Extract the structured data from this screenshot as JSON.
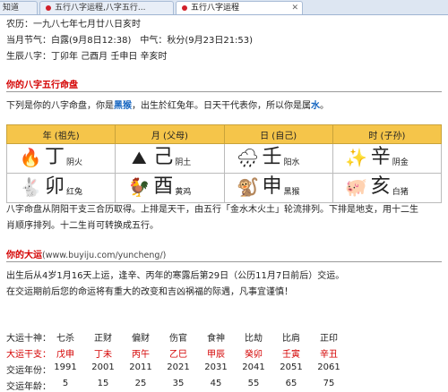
{
  "tabs": [
    {
      "label": "知道"
    },
    {
      "label": "五行八字运程,八字五行..."
    },
    {
      "label": "五行八字运程"
    }
  ],
  "header": {
    "lunar_line": "农历：一九八七年七月廿八日亥时",
    "solar_term": "当月节气：白露(9月8日12:38)　中气：秋分(9月23日21:53)",
    "birth_pillars": "生辰八字：丁卯年 己酉月 壬申日 辛亥时"
  },
  "bazi": {
    "title": "你的八字五行命盘",
    "intro_prefix": "下列是你的八字命盘，你是",
    "intro_mid1": "，出生於红兔年。日天干代表你，所以你是属",
    "intro_end": "。",
    "highlight1": "黑猴",
    "highlight2": "水",
    "headers": [
      "年 (祖先)",
      "月 (父母)",
      "日 (自己)",
      "时 (子孙)"
    ],
    "stems": [
      {
        "char": "丁",
        "desc": "阴火",
        "icon": "fire-icon",
        "glyph": "🔥"
      },
      {
        "char": "己",
        "desc": "阴土",
        "icon": "earth-icon",
        "glyph": "⛰"
      },
      {
        "char": "壬",
        "desc": "阳水",
        "icon": "rain-icon",
        "glyph": "🌧"
      },
      {
        "char": "辛",
        "desc": "阴金",
        "icon": "coins-icon",
        "glyph": "✨"
      }
    ],
    "branches": [
      {
        "char": "卯",
        "desc": "红兔",
        "icon": "rabbit-icon",
        "glyph": "🐇"
      },
      {
        "char": "酉",
        "desc": "黄鸡",
        "icon": "rooster-icon",
        "glyph": "🐓"
      },
      {
        "char": "申",
        "desc": "黑猴",
        "icon": "monkey-icon",
        "glyph": "🐒"
      },
      {
        "char": "亥",
        "desc": "白猪",
        "icon": "pig-icon",
        "glyph": "🐖"
      }
    ],
    "explanation_1": "八字命盘从阴阳干支三合历取得。上排是天干，由五行「金水木火土」轮流排列。下排是地支，用十二生",
    "explanation_2": "肖顺序排列。十二生肖可转换成五行。"
  },
  "dayun": {
    "title": "你的大运",
    "url": "(www.buyiju.com/yuncheng/)",
    "desc_1": "出生后从4岁1月16天上运，逢辛、丙年的寒露后第29日（公历11月7日前后）交运。",
    "desc_2": "在交运期前后您的命运将有重大的改变和吉凶祸福的际遇，凡事宜谨慎！",
    "labels": [
      "大运十神：",
      "大运干支：",
      "交运年份：",
      "交运年龄："
    ],
    "ten_gods": [
      "七杀",
      "正财",
      "偏财",
      "伤官",
      "食神",
      "比劫",
      "比肩",
      "正印"
    ],
    "pillars": [
      "戊申",
      "丁未",
      "丙午",
      "乙巳",
      "甲辰",
      "癸卯",
      "壬寅",
      "辛丑"
    ],
    "years": [
      "1991",
      "2001",
      "2011",
      "2021",
      "2031",
      "2041",
      "2051",
      "2061"
    ],
    "ages": [
      "5",
      "15",
      "25",
      "35",
      "45",
      "55",
      "65",
      "75"
    ]
  },
  "colors": {
    "accent_red": "#d40000",
    "header_gold": "#f5c54a",
    "link_blue": "#1565c0"
  }
}
